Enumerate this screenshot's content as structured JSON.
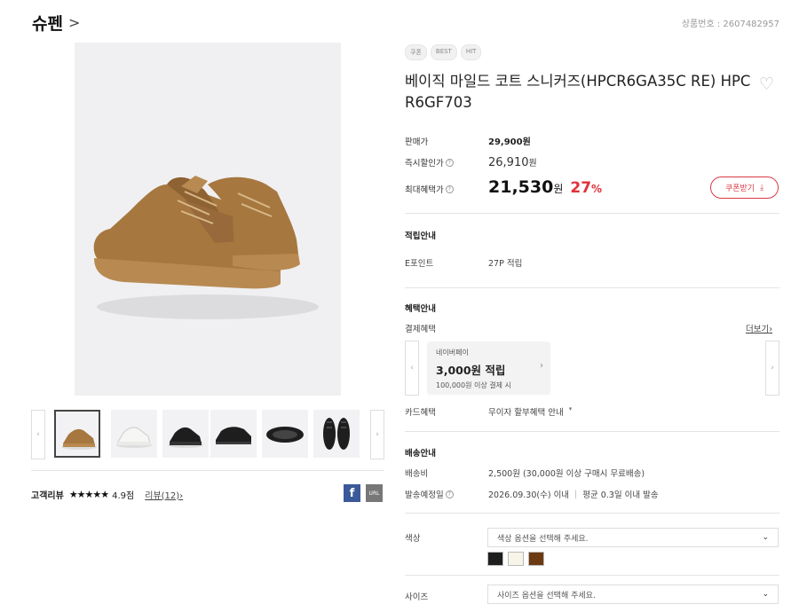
{
  "header": {
    "brand": "슈펜",
    "brand_chevron": ">",
    "product_no": "상품번호 : 2607482957"
  },
  "gallery": {
    "prev_arrow": "‹",
    "next_arrow": "›",
    "thumbnails": [
      "camel-sneaker",
      "white-sneaker",
      "black-sneaker-1",
      "black-sneaker-2",
      "black-sole",
      "black-sneaker-top"
    ]
  },
  "reviews": {
    "title": "고객리뷰",
    "stars": "★★★★★",
    "score": "4.9점",
    "link": "리뷰(12)",
    "link_chevron": "›"
  },
  "share": {
    "facebook": "f",
    "url": "URL"
  },
  "product": {
    "tags": [
      "쿠폰",
      "BEST",
      "HIT"
    ],
    "title": "베이직 마일드 코트 스니커즈(HPCR6GA35C RE) HPCR6GF703",
    "wish_icon": "♡"
  },
  "prices": {
    "sale_label": "판매가",
    "sale_value": "29,900원",
    "now_label": "즉시할인가",
    "now_value": "26,910",
    "now_unit": "원",
    "max_label": "최대혜택가",
    "max_value": "21,530",
    "max_unit": "원",
    "percent": "27",
    "percent_unit": "%",
    "coupon_button": "쿠폰받기",
    "coupon_icon": "⤓",
    "help_mark": "?"
  },
  "points": {
    "title": "적립안내",
    "label": "E포인트",
    "value": "27P 적립"
  },
  "benefits": {
    "title": "혜택안내",
    "payment_label": "결제혜택",
    "more": "더보기",
    "more_chevron": "›",
    "card": {
      "name": "네이버페이",
      "amount": "3,000원 적립",
      "condition": "100,000원 이상 결제 시",
      "chevron": "›"
    },
    "card_label": "카드혜택",
    "card_value": "무이자 할부혜택 안내",
    "card_caret": "▾"
  },
  "delivery": {
    "title": "배송안내",
    "fee_label": "배송비",
    "fee_value": "2,500원 (30,000원 이상 구매시 무료배송)",
    "date_label": "발송예정일",
    "date_value": "2026.09.30(수) 이내",
    "date_sep": "|",
    "date_avg": "평균 0.3일 이내 발송"
  },
  "options": {
    "color_label": "색상",
    "color_placeholder": "색상 옵션을 선택해 주세요.",
    "size_label": "사이즈",
    "size_placeholder": "사이즈 옵션을 선택해 주세요.",
    "caret": "⌄",
    "swatches": [
      "#1e1e1e",
      "#f7f4e8",
      "#6b3a12"
    ]
  }
}
